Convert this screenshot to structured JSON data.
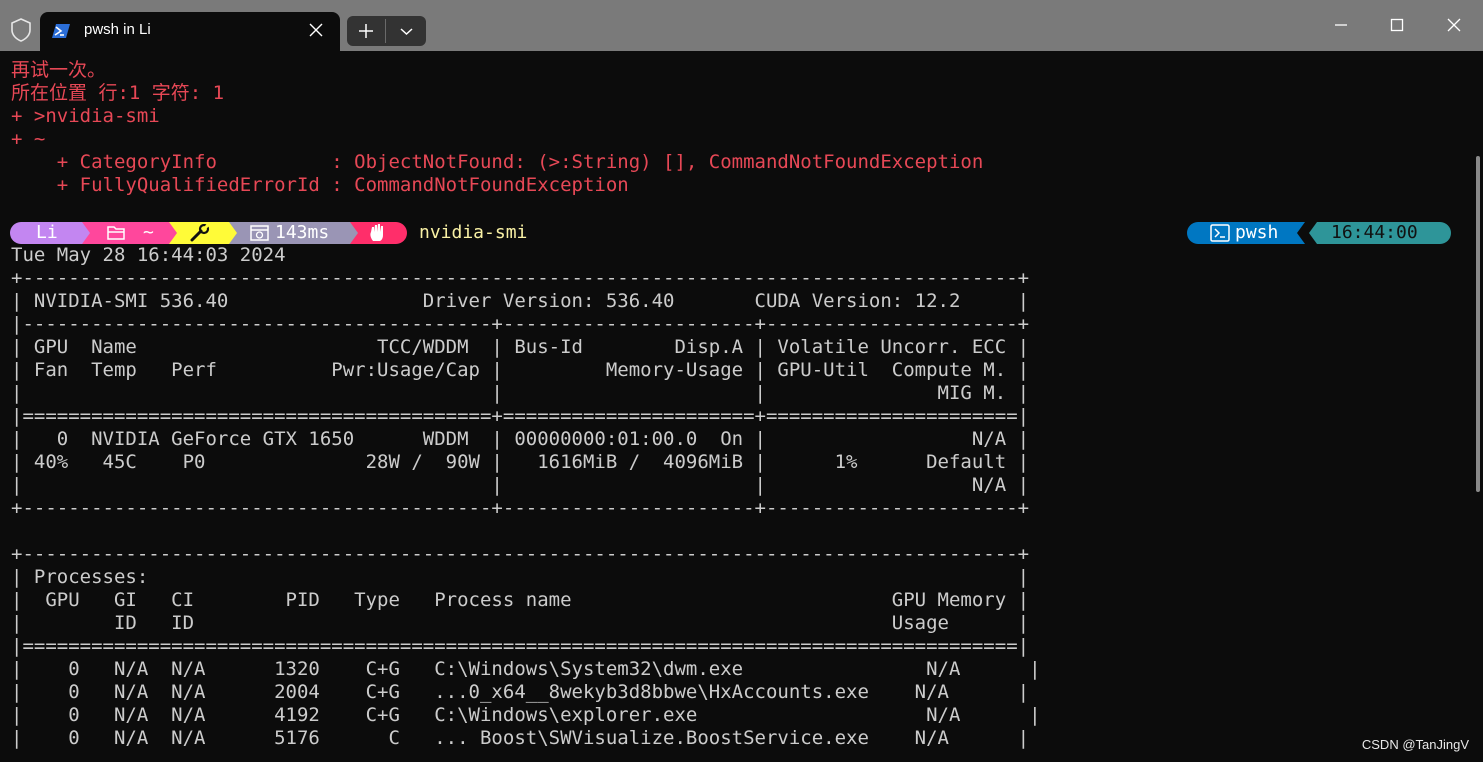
{
  "window": {
    "tab_title": "pwsh in Li"
  },
  "colors": {
    "error": "#e74856",
    "prompt_user_bg": "#c386f1",
    "prompt_path_bg": "#ff479c",
    "prompt_git_bg": "#fffb38",
    "prompt_time_bg": "#9a95b5",
    "prompt_status_bg": "#ff2e6a",
    "prompt_command": "#f9f1a5",
    "right_shell_bg": "#0077c2",
    "right_clock_bg": "#2e9599"
  },
  "error_block": [
    "再试一次。",
    "所在位置 行:1 字符: 1",
    "+ >nvidia-smi",
    "+ ~",
    "    + CategoryInfo          : ObjectNotFound: (>:String) [], CommandNotFoundException",
    "    + FullyQualifiedErrorId : CommandNotFoundException"
  ],
  "prompt": {
    "user": "Li",
    "path": "~",
    "exec_time": "143ms",
    "command": "nvidia-smi",
    "shell": "pwsh",
    "clock": "16:44:00"
  },
  "output": [
    "Tue May 28 16:44:03 2024",
    "+---------------------------------------------------------------------------------------+",
    "| NVIDIA-SMI 536.40                 Driver Version: 536.40       CUDA Version: 12.2     |",
    "|-----------------------------------------+----------------------+----------------------+",
    "| GPU  Name                     TCC/WDDM  | Bus-Id        Disp.A | Volatile Uncorr. ECC |",
    "| Fan  Temp   Perf          Pwr:Usage/Cap |         Memory-Usage | GPU-Util  Compute M. |",
    "|                                         |                      |               MIG M. |",
    "|=========================================+======================+======================|",
    "|   0  NVIDIA GeForce GTX 1650      WDDM  | 00000000:01:00.0  On |                  N/A |",
    "| 40%   45C    P0              28W /  90W |   1616MiB /  4096MiB |      1%      Default |",
    "|                                         |                      |                  N/A |",
    "+-----------------------------------------+----------------------+----------------------+",
    "",
    "+---------------------------------------------------------------------------------------+",
    "| Processes:                                                                            |",
    "|  GPU   GI   CI        PID   Type   Process name                            GPU Memory |",
    "|        ID   ID                                                             Usage      |",
    "|=======================================================================================|",
    "|    0   N/A  N/A      1320    C+G   C:\\Windows\\System32\\dwm.exe                N/A      |",
    "|    0   N/A  N/A      2004    C+G   ...0_x64__8wekyb3d8bbwe\\HxAccounts.exe    N/A      |",
    "|    0   N/A  N/A      4192    C+G   C:\\Windows\\explorer.exe                    N/A      |",
    "|    0   N/A  N/A      5176      C   ... Boost\\SWVisualize.BoostService.exe    N/A      |"
  ],
  "watermark": "CSDN @TanJingV"
}
